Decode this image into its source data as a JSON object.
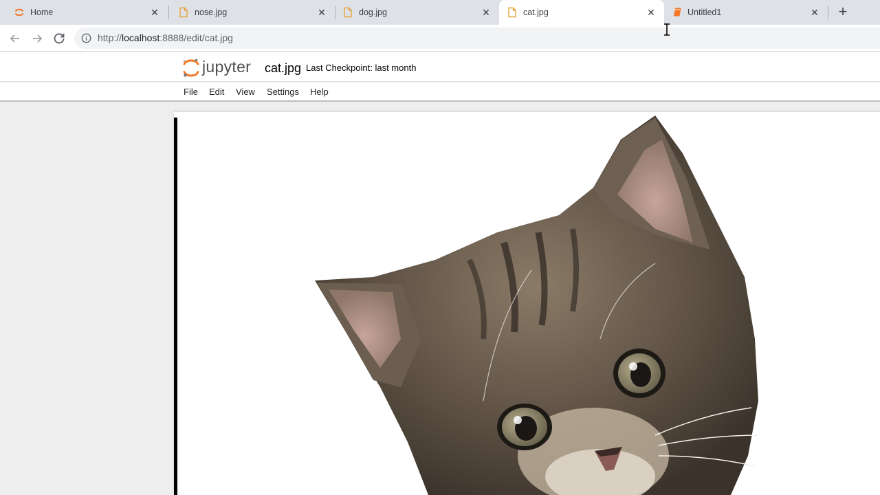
{
  "browser": {
    "tabs": [
      {
        "title": "Home",
        "icon": "jupyter-logo-icon",
        "active": false
      },
      {
        "title": "nose.jpg",
        "icon": "file-icon",
        "active": false
      },
      {
        "title": "dog.jpg",
        "icon": "file-icon",
        "active": false
      },
      {
        "title": "cat.jpg",
        "icon": "file-icon",
        "active": true
      },
      {
        "title": "Untitled1",
        "icon": "notebook-icon",
        "active": false
      }
    ],
    "close_glyph": "✕",
    "newtab_glyph": "+",
    "address": {
      "prefix": "http://",
      "host": "localhost",
      "rest": ":8888/edit/cat.jpg"
    }
  },
  "jupyter": {
    "brand": "jupyter",
    "document_name": "cat.jpg",
    "checkpoint": "Last Checkpoint: last month",
    "menu": [
      "File",
      "Edit",
      "View",
      "Settings",
      "Help"
    ]
  },
  "viewer": {
    "image_subject": "tabby-kitten-photo"
  },
  "colors": {
    "tab_strip": "#dee1e6",
    "jupyter_orange": "#f37726",
    "file_icon": "#e8a33d"
  }
}
